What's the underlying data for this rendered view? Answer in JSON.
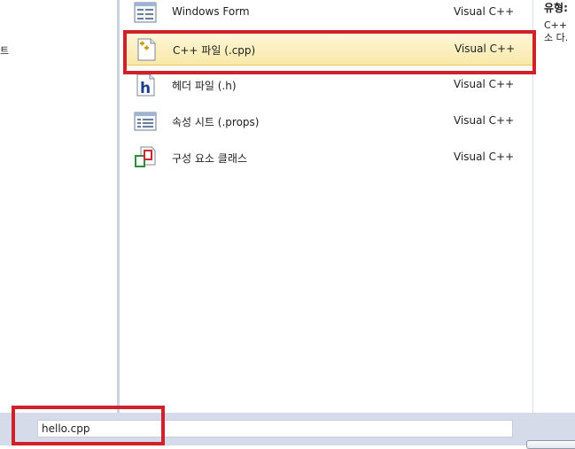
{
  "left_pane": {
    "label": "트"
  },
  "templates": [
    {
      "name": "Windows Form",
      "language": "Visual C++",
      "icon": "form-icon",
      "selected": false
    },
    {
      "name": "C++ 파일 (.cpp)",
      "language": "Visual C++",
      "icon": "cpp-file-icon",
      "selected": true
    },
    {
      "name": "헤더 파일 (.h)",
      "language": "Visual C++",
      "icon": "header-file-icon",
      "selected": false
    },
    {
      "name": "속성 시트 (.props)",
      "language": "Visual C++",
      "icon": "property-sheet-icon",
      "selected": false
    },
    {
      "name": "구성 요소 클래스",
      "language": "Visual C++",
      "icon": "component-class-icon",
      "selected": false
    }
  ],
  "info_pane": {
    "type_label": "유형:",
    "description": "C++ 소 다."
  },
  "name_field": {
    "value": "hello.cpp"
  },
  "colors": {
    "highlight": "#d0202a",
    "selected_row": "#f9e9a8",
    "bottom_bar": "#d6dbe9"
  }
}
